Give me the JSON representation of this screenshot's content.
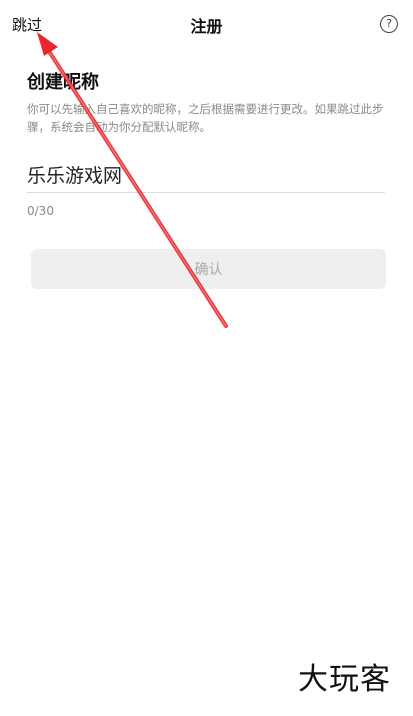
{
  "header": {
    "skip_label": "跳过",
    "title": "注册",
    "help_symbol": "?"
  },
  "main": {
    "section_title": "创建昵称",
    "description": "你可以先输入自己喜欢的昵称，之后根据需要进行更改。如果跳过此步骤，系统会自动为你分配默认昵称。",
    "nickname_value": "乐乐游戏网",
    "char_count": "0/30",
    "confirm_label": "确认"
  },
  "watermark": {
    "text": "大玩客"
  },
  "colors": {
    "annotation_arrow": "#e8262b",
    "button_bg": "#efefef",
    "button_text": "#a8a8a8"
  },
  "icons": {
    "help": "question-circle-icon",
    "annotation": "red-arrow-icon"
  }
}
